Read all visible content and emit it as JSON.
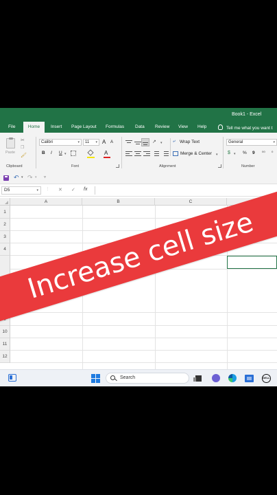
{
  "window": {
    "title": "Book1 - Excel"
  },
  "tabs": [
    "File",
    "Home",
    "Insert",
    "Page Layout",
    "Formulas",
    "Data",
    "Review",
    "View",
    "Help"
  ],
  "active_tab": "Home",
  "tell_me": "Tell me what you want t",
  "ribbon": {
    "clipboard": {
      "paste_label": "Paste",
      "group_label": "Clipboard"
    },
    "font": {
      "name": "Calibri",
      "size": "11",
      "bold": "B",
      "italic": "I",
      "underline": "U",
      "grow": "A",
      "shrink": "A",
      "font_color_glyph": "A",
      "group_label": "Font"
    },
    "alignment": {
      "wrap_text": "Wrap Text",
      "merge_center": "Merge & Center",
      "group_label": "Alignment"
    },
    "number": {
      "format": "General",
      "percent": "%",
      "comma": "9",
      "group_label": "Number"
    }
  },
  "formula_bar": {
    "name_box": "D5",
    "cancel": "✕",
    "enter": "✓",
    "fx": "fx",
    "value": ""
  },
  "grid": {
    "columns": [
      "A",
      "B",
      "C"
    ],
    "rows": [
      "1",
      "2",
      "3",
      "4",
      "9",
      "10",
      "11",
      "12"
    ],
    "active_cell": "D5"
  },
  "taskbar": {
    "search_placeholder": "Search"
  },
  "banner": {
    "text": "Increase cell size",
    "color": "#ea3a3c"
  },
  "colors": {
    "excel_green": "#217346",
    "ribbon_bg": "#f3f3f3",
    "grid_line": "#e3e3e3"
  }
}
